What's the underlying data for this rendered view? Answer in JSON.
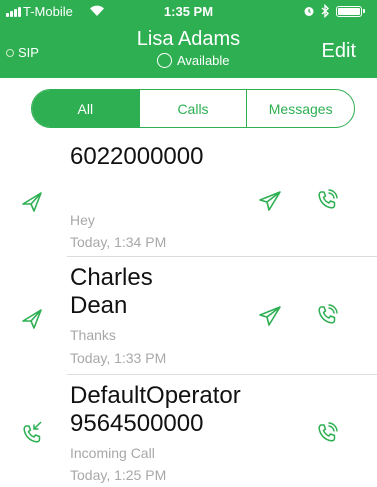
{
  "status_bar": {
    "carrier": "T-Mobile",
    "time": "1:35 PM",
    "icons": [
      "signal-icon",
      "wifi-icon",
      "alarm-icon",
      "bluetooth-icon",
      "battery-icon"
    ]
  },
  "header": {
    "sip_label": "SIP",
    "contact_name": "Lisa Adams",
    "status": "Available",
    "edit_label": "Edit"
  },
  "tabs": [
    {
      "label": "All",
      "selected": true
    },
    {
      "label": "Calls",
      "selected": false
    },
    {
      "label": "Messages",
      "selected": false
    }
  ],
  "history": [
    {
      "title": "6022000000",
      "subtitle": "Hey",
      "timestamp": "Today, 1:34 PM",
      "type": "message",
      "left_icon": "sent-message-icon",
      "actions": [
        "send-message-icon",
        "call-icon"
      ]
    },
    {
      "title": "Charles Dean",
      "subtitle": "Thanks",
      "timestamp": "Today, 1:33 PM",
      "type": "message",
      "left_icon": "sent-message-icon",
      "actions": [
        "send-message-icon",
        "call-icon"
      ]
    },
    {
      "title": "DefaultOperator 9564500000",
      "subtitle": "Incoming Call",
      "timestamp": "Today, 1:25 PM",
      "type": "call",
      "left_icon": "incoming-call-icon",
      "actions": [
        "call-icon"
      ]
    }
  ],
  "colors": {
    "brand_green": "#2daf52",
    "text_primary": "#111111",
    "text_secondary": "#a8a8a8",
    "divider": "#dcdcdc"
  }
}
